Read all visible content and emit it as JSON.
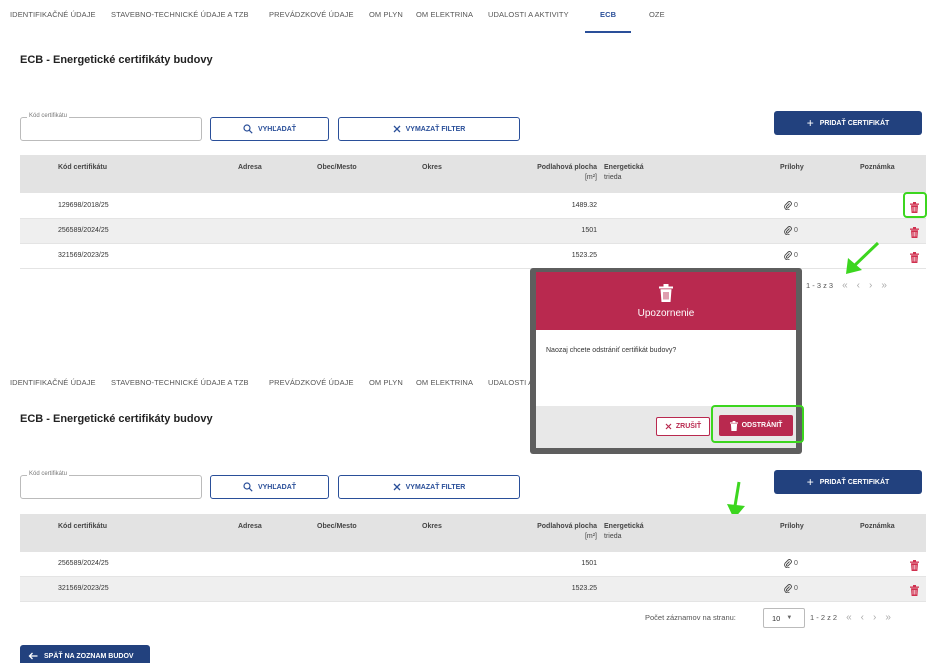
{
  "tabs": [
    "IDENTIFIKAČNÉ ÚDAJE",
    "STAVEBNO-TECHNICKÉ ÚDAJE A TZB",
    "PREVÁDZKOVÉ ÚDAJE",
    "OM PLYN",
    "OM ELEKTRINA",
    "UDALOSTI A AKTIVITY",
    "ECB",
    "OZE"
  ],
  "tabs_truncated_last": "UDALOSTI A",
  "active_tab": "ECB",
  "page_title": "ECB - Energetické certifikáty budovy",
  "filter": {
    "field_label": "Kód certifikátu",
    "field_value": "",
    "search_label": "VYHĽADAŤ",
    "clear_label": "VYMAZAŤ FILTER"
  },
  "add_label": "PRIDAŤ CERTIFIKÁT",
  "columns": {
    "code": "Kód certifikátu",
    "address": "Adresa",
    "city": "Obec/Mesto",
    "district": "Okres",
    "area": "Podlahová plocha",
    "area_unit": "[m²]",
    "energy": "Energetická",
    "energy_sub": "trieda",
    "attachments": "Prílohy",
    "note": "Poznámka"
  },
  "before": {
    "rows": [
      {
        "code": "129698/2018/25",
        "area": "1489.32",
        "attachments": "0"
      },
      {
        "code": "256589/2024/25",
        "area": "1501",
        "attachments": "0"
      },
      {
        "code": "321569/2023/25",
        "area": "1523.25",
        "attachments": "0"
      }
    ],
    "pager_range": "1 - 3 z 3"
  },
  "after": {
    "rows": [
      {
        "code": "256589/2024/25",
        "area": "1501",
        "attachments": "0"
      },
      {
        "code": "321569/2023/25",
        "area": "1523.25",
        "attachments": "0"
      }
    ],
    "per_page_label": "Počet záznamov na stranu:",
    "per_page_value": "10",
    "pager_range": "1 - 2 z 2"
  },
  "modal": {
    "title": "Upozornenie",
    "message": "Naozaj chcete odstrániť certifikát budovy?",
    "cancel_label": "ZRUŠIŤ",
    "delete_label": "ODSTRÁNIŤ"
  },
  "back_label": "SPÄŤ NA ZOZNAM BUDOV",
  "colors": {
    "primary": "#22417e",
    "accent": "#2a4f99",
    "danger": "#b9294f",
    "highlight": "#3cd61f",
    "header_bg": "#e3e3e3"
  },
  "icons": [
    "search-icon",
    "close-icon",
    "plus-icon",
    "trash-icon",
    "paperclip-icon",
    "arrow-left-icon",
    "chevron-double-left-icon",
    "chevron-left-icon",
    "chevron-right-icon",
    "chevron-double-right-icon",
    "caret-down-icon"
  ]
}
